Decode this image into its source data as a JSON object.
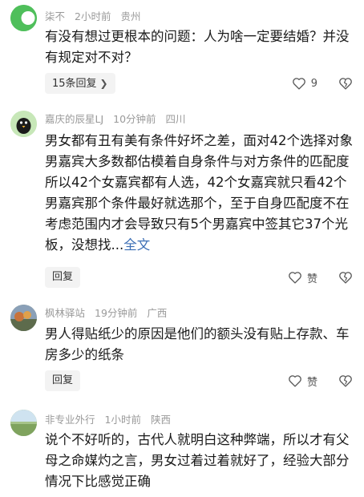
{
  "comments": [
    {
      "username": "柒不",
      "time": "2小时前",
      "location": "贵州",
      "avatar_icon": "green-toggle-icon",
      "text": "有没有想过更根本的问题：人为啥一定要结婚？并没有规定对不对？",
      "reply_label": "15条回复",
      "like_count": "9"
    },
    {
      "username": "嘉庆的辰星LJ",
      "time": "10分钟前",
      "location": "四川",
      "avatar_icon": "bird-avatar-icon",
      "text": "男女都有丑有美有条件好坏之差，面对42个选择对象男嘉宾大多数都估模着自身条件与对方条件的匹配度所以42个女嘉宾都有人选，42个女嘉宾就只看42个男嘉宾那个条件最好就选那个，至于自身匹配度不在考虑范围内才会导致只有5个男嘉宾中签其它37个光板，没想找...",
      "fulltext_label": "全文",
      "reply_label": "回复",
      "like_label": "赞"
    },
    {
      "username": "枫林驿站",
      "time": "19分钟前",
      "location": "广西",
      "avatar_icon": "landscape-avatar-icon",
      "text": "男人得贴纸少的原因是他们的额头没有贴上存款、车房多少的纸条",
      "reply_label": "回复",
      "like_label": "赞"
    },
    {
      "username": "非专业外行",
      "time": "1小时前",
      "location": "陕西",
      "avatar_icon": "field-avatar-icon",
      "text": "说个不好听的，古代人就明白这种弊端，所以才有父母之命媒灼之言，男女过着过着就好了，经验大部分情况下比感觉正确"
    }
  ],
  "colors": {
    "meta": "#9a9a9a",
    "link": "#3d6fb5",
    "reply_bg": "#f3f3f3"
  }
}
